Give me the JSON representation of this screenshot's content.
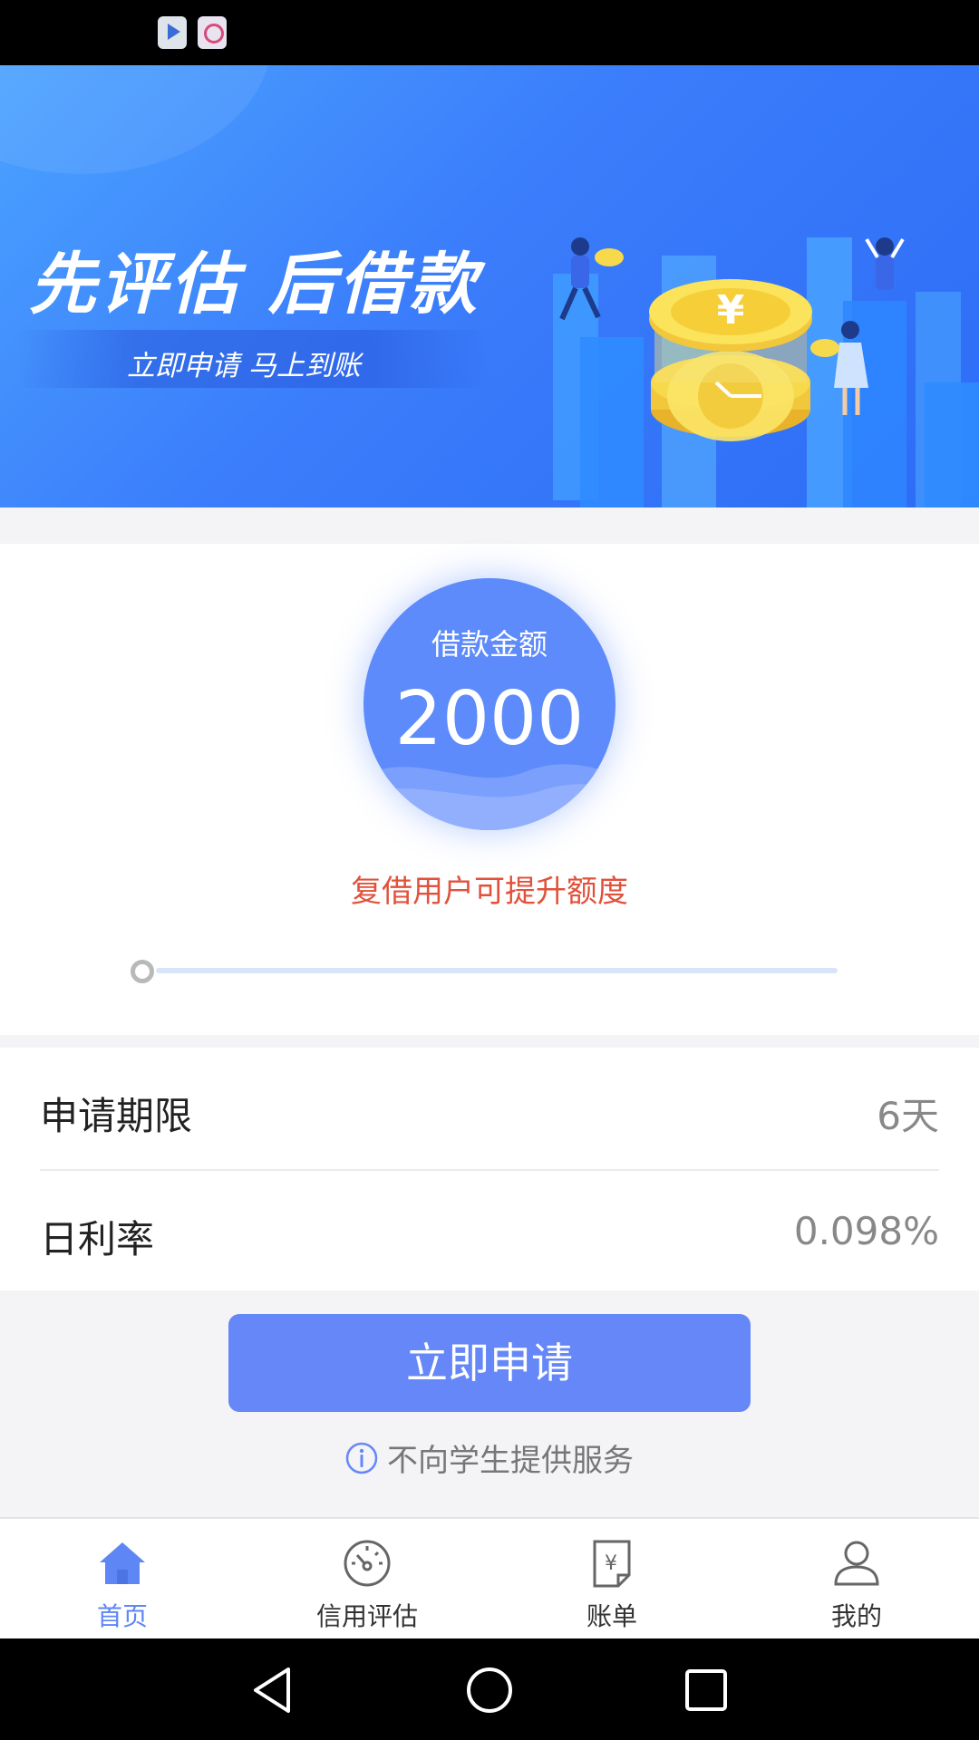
{
  "banner": {
    "title": "先评估 后借款",
    "subtitle": "立即申请 马上到账"
  },
  "loan": {
    "amount_label": "借款金额",
    "amount": "2000",
    "promo_text": "复借用户可提升额度",
    "slider_position": 0
  },
  "details": [
    {
      "label": "申请期限",
      "value": "6天"
    },
    {
      "label": "日利率",
      "value": "0.098%"
    }
  ],
  "apply_button": "立即申请",
  "notice": "不向学生提供服务",
  "bottom_nav": [
    {
      "label": "首页",
      "icon": "home-icon",
      "active": true
    },
    {
      "label": "信用评估",
      "icon": "gauge-icon",
      "active": false
    },
    {
      "label": "账单",
      "icon": "bill-icon",
      "active": false
    },
    {
      "label": "我的",
      "icon": "user-icon",
      "active": false
    }
  ],
  "colors": {
    "accent": "#5e86f5",
    "button": "#6587f8",
    "promo": "#e2513b",
    "banner": "#3b7dfb"
  }
}
